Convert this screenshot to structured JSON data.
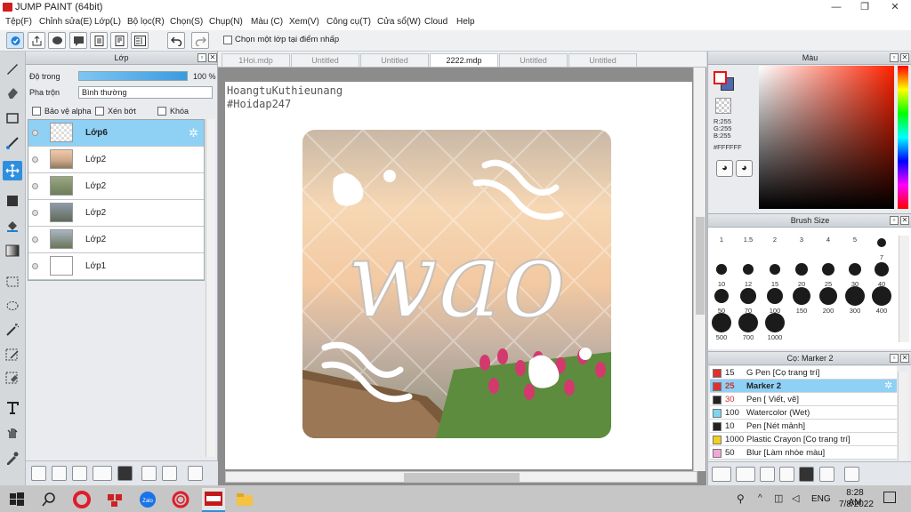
{
  "window": {
    "title": "JUMP PAINT (64bit)",
    "min_glyph": "—",
    "max_glyph": "❐",
    "close_glyph": "✕"
  },
  "menu": [
    "Tệp(F)",
    "Chỉnh sửa(E)",
    "Lớp(L)",
    "Bộ lọc(R)",
    "Chọn(S)",
    "Chụp(N)",
    "Màu (C)",
    "Xem(V)",
    "Công cụ(T)",
    "Cửa sổ(W)",
    "Cloud",
    "Help"
  ],
  "toolbar": {
    "checkbox_label": "Chọn một lớp tại điểm nhấp"
  },
  "layer_panel": {
    "title": "Lớp",
    "opacity_label": "Độ trong",
    "opacity_value": "100 %",
    "opacity": 1.0,
    "blend_label": "Pha trộn",
    "blend_value": "Bình thường",
    "protect_alpha": "Bảo vệ alpha",
    "clipping": "Xén bớt",
    "lock": "Khóa",
    "layers": [
      {
        "name": "Lớp6",
        "selected": true
      },
      {
        "name": "Lớp2",
        "selected": false
      },
      {
        "name": "Lớp2",
        "selected": false
      },
      {
        "name": "Lớp2",
        "selected": false
      },
      {
        "name": "Lớp2",
        "selected": false
      },
      {
        "name": "Lớp1",
        "selected": false
      }
    ]
  },
  "tabs": [
    {
      "label": "1Hoi.mdp",
      "active": false
    },
    {
      "label": "Untitled",
      "active": false
    },
    {
      "label": "Untitled",
      "active": false
    },
    {
      "label": "2222.mdp",
      "active": true
    },
    {
      "label": "Untitled",
      "active": false
    },
    {
      "label": "Untitled",
      "active": false
    }
  ],
  "canvas": {
    "text_line1": "HoangtuKuthieunang",
    "text_line2": "#Hoidap247",
    "art_word": "wao"
  },
  "color_panel": {
    "title": "Màu",
    "r": "R:255",
    "g": "G:255",
    "b": "B:255",
    "hex": "#FFFFFF",
    "fg_color": "#FFFFFF",
    "bg_color": "#4C6BB0"
  },
  "brush_panel": {
    "title": "Brush Size",
    "sizes": [
      "1",
      "1.5",
      "2",
      "3",
      "4",
      "5",
      "7",
      "10",
      "12",
      "15",
      "20",
      "25",
      "30",
      "40",
      "50",
      "70",
      "100",
      "150",
      "200",
      "300",
      "400",
      "500",
      "700",
      "1000"
    ]
  },
  "brush_list_panel": {
    "title": "Cọ: Marker 2",
    "items": [
      {
        "size": "15",
        "name": "G Pen [Cọ trang trí]",
        "color": "#E23030",
        "selected": false
      },
      {
        "size": "25",
        "name": "Marker 2",
        "color": "#E23030",
        "selected": true
      },
      {
        "size": "30",
        "name": "Pen [ Viết, vẽ]",
        "color": "#222222",
        "selected": false
      },
      {
        "size": "100",
        "name": "Watercolor (Wet)",
        "color": "#7FD4F0",
        "selected": false
      },
      {
        "size": "10",
        "name": "Pen [Nét mảnh]",
        "color": "#222222",
        "selected": false
      },
      {
        "size": "1000",
        "name": "Plastic Crayon [Cọ trang trí]",
        "color": "#F0D020",
        "selected": false
      },
      {
        "size": "50",
        "name": "Blur [Làm nhòe màu]",
        "color": "#F0A8D8",
        "selected": false
      }
    ]
  },
  "taskbar": {
    "lang": "ENG",
    "time": "8:28 AM",
    "date": "7/8/2022"
  }
}
